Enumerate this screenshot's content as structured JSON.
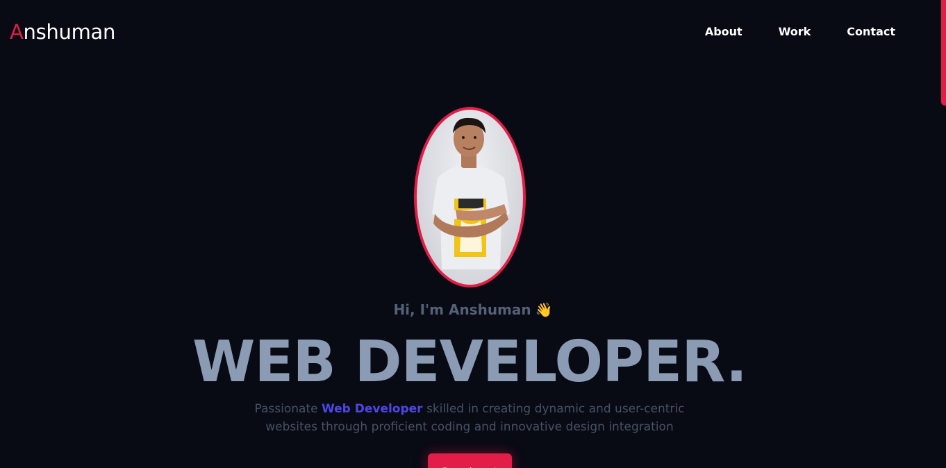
{
  "header": {
    "logo_first_letter": "A",
    "logo_rest": "nshuman",
    "nav": [
      {
        "label": "About"
      },
      {
        "label": "Work"
      },
      {
        "label": "Contact"
      }
    ]
  },
  "hero": {
    "greeting": "Hi, I'm Anshuman",
    "greeting_emoji": "👋",
    "headline": "WEB DEVELOPER.",
    "description_prefix": "Passionate",
    "description_highlight": "Web Developer",
    "description_suffix": "skilled in creating dynamic and user-centric websites through proficient coding and innovative design integration",
    "cta_label": "Reach out"
  },
  "colors": {
    "background": "#080a14",
    "accent": "#e11d48",
    "highlight": "#4f46e5",
    "headline": "#8a9bb3"
  }
}
